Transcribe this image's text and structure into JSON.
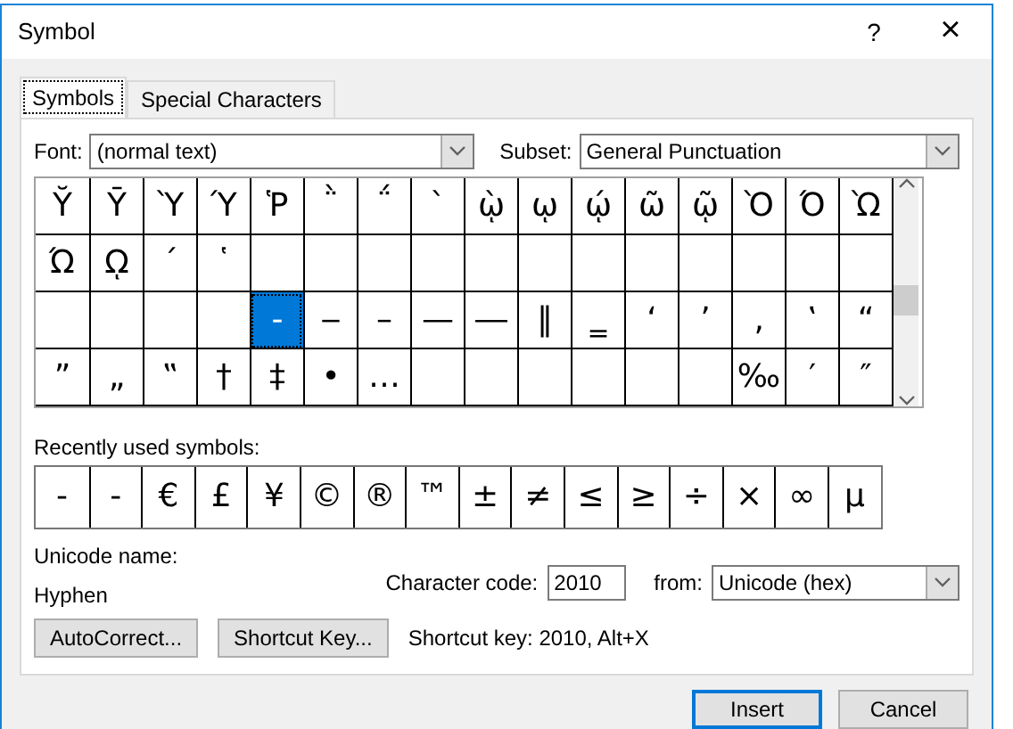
{
  "window": {
    "title": "Symbol",
    "help": "?",
    "close": "×"
  },
  "tabs": [
    {
      "label": "Symbols",
      "selected": true
    },
    {
      "label": "Special Characters",
      "selected": false
    }
  ],
  "font": {
    "label": "Font:",
    "value": "(normal text)"
  },
  "subset": {
    "label": "Subset:",
    "value": "General Punctuation"
  },
  "symbol_grid": [
    [
      {
        "kind": "symbol",
        "char": "Ῠ",
        "selected": false
      },
      {
        "kind": "symbol",
        "char": "Ῡ",
        "selected": false
      },
      {
        "kind": "symbol",
        "char": "Ὺ",
        "selected": false
      },
      {
        "kind": "symbol",
        "char": "Ύ",
        "selected": false
      },
      {
        "kind": "symbol",
        "char": "Ῥ",
        "selected": false
      },
      {
        "kind": "symbol",
        "char": "῭",
        "selected": false
      },
      {
        "kind": "symbol",
        "char": "΅",
        "selected": false
      },
      {
        "kind": "symbol",
        "char": "`",
        "selected": false
      },
      {
        "kind": "symbol",
        "char": "ῲ",
        "selected": false
      },
      {
        "kind": "symbol",
        "char": "ῳ",
        "selected": false
      },
      {
        "kind": "symbol",
        "char": "ῴ",
        "selected": false
      },
      {
        "kind": "symbol",
        "char": "ῶ",
        "selected": false
      },
      {
        "kind": "symbol",
        "char": "ῷ",
        "selected": false
      },
      {
        "kind": "symbol",
        "char": "Ὸ",
        "selected": false
      },
      {
        "kind": "symbol",
        "char": "Ό",
        "selected": false
      },
      {
        "kind": "symbol",
        "char": "Ὼ",
        "selected": false
      }
    ],
    [
      {
        "kind": "symbol",
        "char": "Ώ",
        "selected": false
      },
      {
        "kind": "symbol",
        "char": "ῼ",
        "selected": false
      },
      {
        "kind": "symbol",
        "char": "´",
        "selected": false
      },
      {
        "kind": "symbol",
        "char": "῾",
        "selected": false
      },
      {
        "kind": "blank"
      },
      {
        "kind": "blank"
      },
      {
        "kind": "blank"
      },
      {
        "kind": "blank"
      },
      {
        "kind": "blank"
      },
      {
        "kind": "blank"
      },
      {
        "kind": "blank"
      },
      {
        "kind": "blank"
      },
      {
        "kind": "blank"
      },
      {
        "kind": "blank"
      },
      {
        "kind": "blank"
      },
      {
        "kind": "blank"
      }
    ],
    [
      {
        "kind": "blank"
      },
      {
        "kind": "blank"
      },
      {
        "kind": "blank"
      },
      {
        "kind": "blank"
      },
      {
        "kind": "symbol",
        "char": "‐",
        "selected": true
      },
      {
        "kind": "symbol",
        "char": "‒",
        "selected": false
      },
      {
        "kind": "symbol",
        "char": "–",
        "selected": false
      },
      {
        "kind": "symbol",
        "char": "—",
        "selected": false
      },
      {
        "kind": "symbol",
        "char": "―",
        "selected": false
      },
      {
        "kind": "symbol",
        "char": "‖",
        "selected": false
      },
      {
        "kind": "symbol",
        "char": "‗",
        "selected": false
      },
      {
        "kind": "symbol",
        "char": "‘",
        "selected": false
      },
      {
        "kind": "symbol",
        "char": "’",
        "selected": false
      },
      {
        "kind": "symbol",
        "char": "‚",
        "selected": false
      },
      {
        "kind": "symbol",
        "char": "‛",
        "selected": false
      },
      {
        "kind": "symbol",
        "char": "“",
        "selected": false
      }
    ],
    [
      {
        "kind": "symbol",
        "char": "”",
        "selected": false
      },
      {
        "kind": "symbol",
        "char": "„",
        "selected": false
      },
      {
        "kind": "symbol",
        "char": "‟",
        "selected": false
      },
      {
        "kind": "symbol",
        "char": "†",
        "selected": false
      },
      {
        "kind": "symbol",
        "char": "‡",
        "selected": false
      },
      {
        "kind": "symbol",
        "char": "•",
        "selected": false
      },
      {
        "kind": "symbol",
        "char": "…",
        "selected": false
      },
      {
        "kind": "blank"
      },
      {
        "kind": "blank"
      },
      {
        "kind": "blank"
      },
      {
        "kind": "blank"
      },
      {
        "kind": "blank"
      },
      {
        "kind": "blank"
      },
      {
        "kind": "symbol",
        "char": "‰",
        "selected": false
      },
      {
        "kind": "symbol",
        "char": "′",
        "selected": false
      },
      {
        "kind": "symbol",
        "char": "″",
        "selected": false
      }
    ]
  ],
  "recent": {
    "label": "Recently used symbols:",
    "symbols": [
      "-",
      "-",
      "€",
      "£",
      "¥",
      "©",
      "®",
      "™",
      "±",
      "≠",
      "≤",
      "≥",
      "÷",
      "×",
      "∞",
      "µ"
    ]
  },
  "unicode_name": {
    "label": "Unicode name:",
    "value": "Hyphen"
  },
  "character_code": {
    "label": "Character code:",
    "value": "2010"
  },
  "from": {
    "label": "from:",
    "value": "Unicode (hex)"
  },
  "autocorrect_button": "AutoCorrect...",
  "shortcut_key_button": "Shortcut Key...",
  "shortcut_text": "Shortcut key: 2010, Alt+X",
  "buttons": [
    {
      "label": "Insert",
      "default": true
    },
    {
      "label": "Cancel",
      "default": false
    }
  ]
}
